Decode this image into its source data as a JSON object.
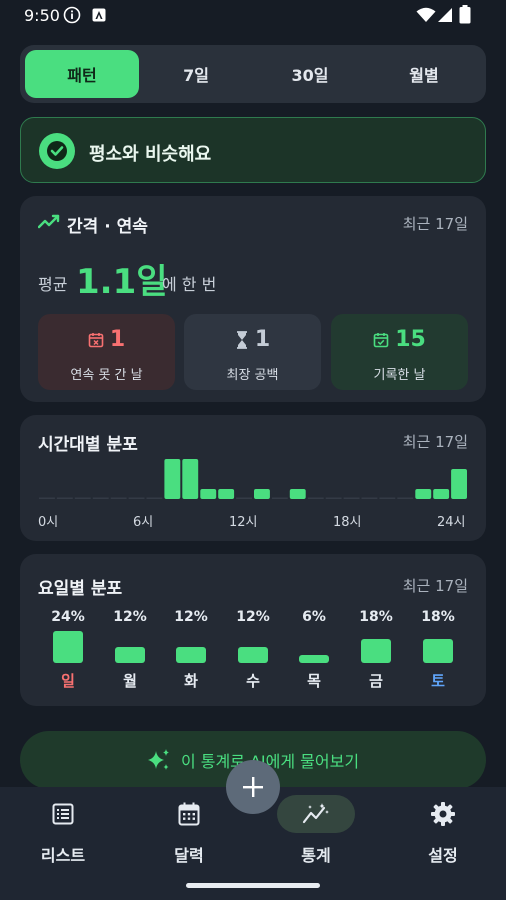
{
  "status_bar": {
    "time": "9:50"
  },
  "tabs": [
    {
      "label": "패턴",
      "active": true
    },
    {
      "label": "7일",
      "active": false
    },
    {
      "label": "30일",
      "active": false
    },
    {
      "label": "월별",
      "active": false
    }
  ],
  "banner": {
    "text": "평소와 비슷해요"
  },
  "interval_card": {
    "title": "간격 · 연속",
    "range": "최근 17일",
    "avg_prefix": "평균",
    "avg_value": "1.1일",
    "avg_suffix": "에 한 번",
    "stats": [
      {
        "value": "1",
        "label": "연속 못 간 날",
        "icon": "calendar-x-icon"
      },
      {
        "value": "1",
        "label": "최장 공백",
        "icon": "hourglass-icon"
      },
      {
        "value": "15",
        "label": "기록한 날",
        "icon": "calendar-check-icon"
      }
    ]
  },
  "hour_card": {
    "title": "시간대별 분포",
    "range": "최근 17일",
    "ticks": [
      "0시",
      "6시",
      "12시",
      "18시",
      "24시"
    ]
  },
  "weekday_card": {
    "title": "요일별 분포",
    "range": "최근 17일",
    "days": [
      {
        "name": "일",
        "pct": "24%"
      },
      {
        "name": "월",
        "pct": "12%"
      },
      {
        "name": "화",
        "pct": "12%"
      },
      {
        "name": "수",
        "pct": "12%"
      },
      {
        "name": "목",
        "pct": "6%"
      },
      {
        "name": "금",
        "pct": "18%"
      },
      {
        "name": "토",
        "pct": "18%"
      }
    ]
  },
  "chart_data": [
    {
      "type": "bar",
      "categories": [
        "0",
        "1",
        "2",
        "3",
        "4",
        "5",
        "6",
        "7",
        "8",
        "9",
        "10",
        "11",
        "12",
        "13",
        "14",
        "15",
        "16",
        "17",
        "18",
        "19",
        "20",
        "21",
        "22",
        "23"
      ],
      "values": [
        0,
        0,
        0,
        0,
        0,
        0,
        0,
        4,
        4,
        1,
        1,
        0,
        1,
        0,
        1,
        0,
        0,
        0,
        0,
        0,
        0,
        1,
        1,
        3
      ],
      "xlabel": "",
      "ylabel": ""
    },
    {
      "type": "bar",
      "categories": [
        "일",
        "월",
        "화",
        "수",
        "목",
        "금",
        "토"
      ],
      "values": [
        24,
        12,
        12,
        12,
        6,
        18,
        18
      ]
    }
  ],
  "ai_button": {
    "label": "이 통계로 AI에게 물어보기"
  },
  "nav": [
    {
      "label": "리스트",
      "icon": "list-icon",
      "active": false
    },
    {
      "label": "달력",
      "icon": "calendar-icon",
      "active": false
    },
    {
      "label": "통계",
      "icon": "stats-icon",
      "active": true
    },
    {
      "label": "설정",
      "icon": "gear-icon",
      "active": false
    }
  ],
  "colors": {
    "accent": "#4ade80",
    "background": "#161c25",
    "card": "#242a34",
    "sunday": "#f87171",
    "saturday": "#60a5fa"
  }
}
